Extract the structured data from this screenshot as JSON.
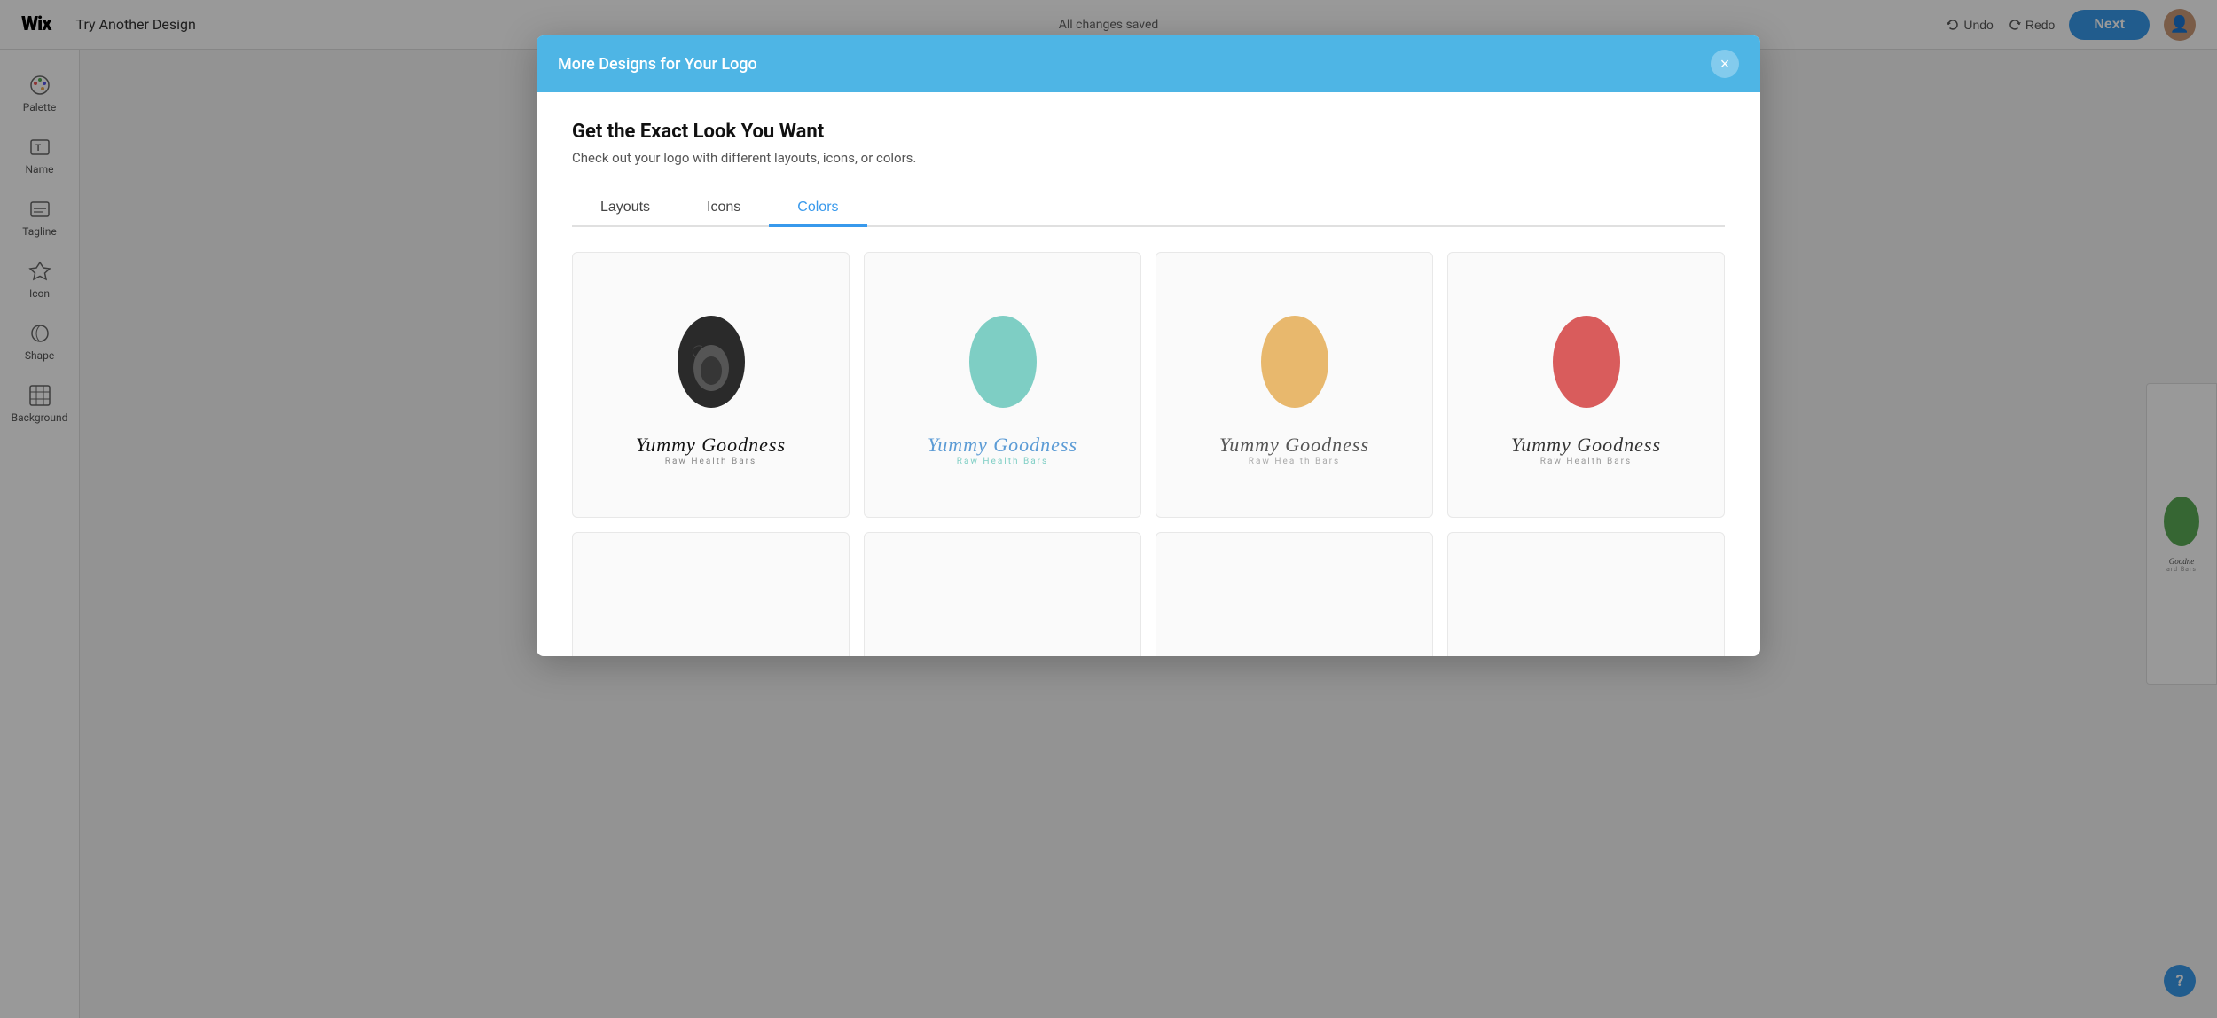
{
  "topbar": {
    "logo": "Wix",
    "title": "Try Another Design",
    "status": "All changes saved",
    "undo_label": "Undo",
    "redo_label": "Redo",
    "next_label": "Next"
  },
  "sidebar": {
    "items": [
      {
        "id": "palette",
        "label": "Palette",
        "icon": "palette-icon"
      },
      {
        "id": "name",
        "label": "Name",
        "icon": "name-icon"
      },
      {
        "id": "tagline",
        "label": "Tagline",
        "icon": "tagline-icon"
      },
      {
        "id": "icon",
        "label": "Icon",
        "icon": "icon-icon"
      },
      {
        "id": "shape",
        "label": "Shape",
        "icon": "shape-icon"
      },
      {
        "id": "background",
        "label": "Background",
        "icon": "background-icon"
      }
    ]
  },
  "modal": {
    "header_title": "More Designs for Your Logo",
    "headline": "Get the Exact Look You Want",
    "subtext": "Check out your logo with different layouts, icons, or colors.",
    "tabs": [
      {
        "id": "layouts",
        "label": "Layouts",
        "active": false
      },
      {
        "id": "icons",
        "label": "Icons",
        "active": false
      },
      {
        "id": "colors",
        "label": "Colors",
        "active": true
      }
    ],
    "close_label": "×"
  },
  "logo_cards": [
    {
      "id": "card-black",
      "name": "Yummy Goodness",
      "tagline": "Raw Health Bars",
      "icon_color": "#2a2a2a",
      "text_color": "#111",
      "tagline_color": "#888"
    },
    {
      "id": "card-teal",
      "name": "Yummy Goodness",
      "tagline": "Raw Health Bars",
      "icon_color": "#7ecec4",
      "text_color": "#5b9bd5",
      "tagline_color": "#7ecec4"
    },
    {
      "id": "card-gold",
      "name": "Yummy Goodness",
      "tagline": "Raw Health Bars",
      "icon_color": "#e8b86d",
      "text_color": "#555",
      "tagline_color": "#aaa"
    },
    {
      "id": "card-red",
      "name": "Yummy Goodness",
      "tagline": "Raw Health Bars",
      "icon_color": "#d95c5c",
      "text_color": "#333",
      "tagline_color": "#999"
    }
  ],
  "partial_card": {
    "name": "Goodne",
    "tagline": "ard Bars",
    "icon_color": "#5aab55"
  },
  "help_label": "?"
}
